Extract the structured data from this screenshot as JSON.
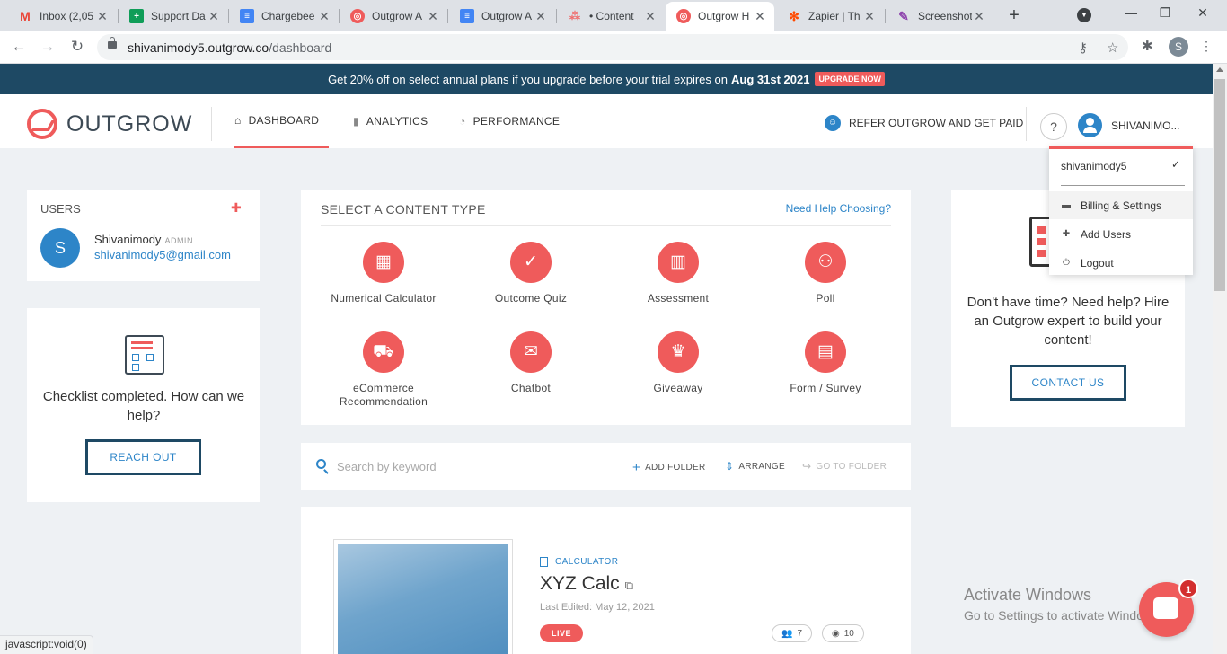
{
  "browser": {
    "tabs": [
      {
        "title": "Inbox (2,05",
        "icon": "gmail-icon",
        "color": "#ea4335",
        "glyph": "M",
        "active": false
      },
      {
        "title": "Support Da",
        "icon": "sheets-icon",
        "color": "#0f9d58",
        "glyph": "+",
        "active": false
      },
      {
        "title": "Chargebee",
        "icon": "docs-icon",
        "color": "#4285f4",
        "glyph": "≡",
        "active": false
      },
      {
        "title": "Outgrow A",
        "icon": "outgrow-icon",
        "color": "#ef5b5b",
        "glyph": "◎",
        "active": false
      },
      {
        "title": "Outgrow A",
        "icon": "docs-icon",
        "color": "#4285f4",
        "glyph": "≡",
        "active": false
      },
      {
        "title": "• Content",
        "icon": "asana-icon",
        "color": "#f06a6a",
        "glyph": "⁂",
        "active": false
      },
      {
        "title": "Outgrow H",
        "icon": "outgrow-icon",
        "color": "#ef5b5b",
        "glyph": "◎",
        "active": true
      },
      {
        "title": "Zapier | Th",
        "icon": "zapier-icon",
        "color": "#ff4a00",
        "glyph": "✻",
        "active": false
      },
      {
        "title": "Screenshot",
        "icon": "feather-icon",
        "color": "#8e44ad",
        "glyph": "✎",
        "active": false
      }
    ],
    "new_tab": "+",
    "url_host": "shivanimody5.outgrow.co",
    "url_path": "/dashboard",
    "profile_initial": "S",
    "status_text": "javascript:void(0)"
  },
  "promo": {
    "text": "Get 20% off on select annual plans if you upgrade before your trial expires on",
    "date": "Aug 31st 2021",
    "cta": "UPGRADE NOW"
  },
  "header": {
    "logo": "OUTGROW",
    "nav": [
      {
        "label": "DASHBOARD",
        "icon": "home-icon",
        "glyph": "⌂"
      },
      {
        "label": "ANALYTICS",
        "icon": "bar-chart-icon",
        "glyph": "▮"
      },
      {
        "label": "PERFORMANCE",
        "icon": "gauge-icon",
        "glyph": "◔"
      }
    ],
    "refer": "REFER OUTGROW AND GET PAID",
    "help": "?",
    "user": "SHIVANIMO..."
  },
  "dropdown": {
    "username": "shivanimody5",
    "check": "✓",
    "items": [
      {
        "label": "Billing & Settings",
        "icon": "billing-icon",
        "glyph": "▬"
      },
      {
        "label": "Add Users",
        "icon": "add-user-icon",
        "glyph": "✚"
      },
      {
        "label": "Logout",
        "icon": "power-icon",
        "glyph": "⏻"
      }
    ]
  },
  "users": {
    "title": "USERS",
    "add_icon": "+",
    "initial": "S",
    "name": "Shivanimody",
    "role": "ADMIN",
    "email": "shivanimody5@gmail.com"
  },
  "checklist": {
    "text": "Checklist completed. How can we help?",
    "button": "REACH OUT"
  },
  "content_types": {
    "title": "SELECT A CONTENT TYPE",
    "help_link": "Need Help Choosing?",
    "items": [
      {
        "label": "Numerical Calculator",
        "icon": "calculator-icon",
        "glyph": "▦"
      },
      {
        "label": "Outcome Quiz",
        "icon": "check-circle-icon",
        "glyph": "✓"
      },
      {
        "label": "Assessment",
        "icon": "bar-chart-icon",
        "glyph": "▥"
      },
      {
        "label": "Poll",
        "icon": "group-icon",
        "glyph": "⚇"
      },
      {
        "label": "eCommerce Recommendation",
        "icon": "cart-icon",
        "glyph": "⛟"
      },
      {
        "label": "Chatbot",
        "icon": "chat-icon",
        "glyph": "✉"
      },
      {
        "label": "Giveaway",
        "icon": "trophy-icon",
        "glyph": "♛"
      },
      {
        "label": "Form / Survey",
        "icon": "clipboard-icon",
        "glyph": "▤"
      }
    ]
  },
  "hire": {
    "text": "Don't have time? Need help? Hire an Outgrow expert to build your content!",
    "button": "CONTACT US"
  },
  "search": {
    "placeholder": "Search by keyword",
    "add_folder": "ADD FOLDER",
    "arrange": "ARRANGE",
    "go_to_folder": "GO TO FOLDER"
  },
  "item": {
    "type": "CALCULATOR",
    "name": "XYZ Calc",
    "edited": "Last Edited: May 12, 2021",
    "status": "LIVE",
    "users_count": "7",
    "views_count": "10"
  },
  "overlay": {
    "activate_title": "Activate Windows",
    "activate_sub": "Go to Settings to activate Windows.",
    "chat_badge": "1"
  },
  "colors": {
    "brand": "#ef5b5b",
    "navy": "#1e4964",
    "link": "#2d85c8"
  }
}
